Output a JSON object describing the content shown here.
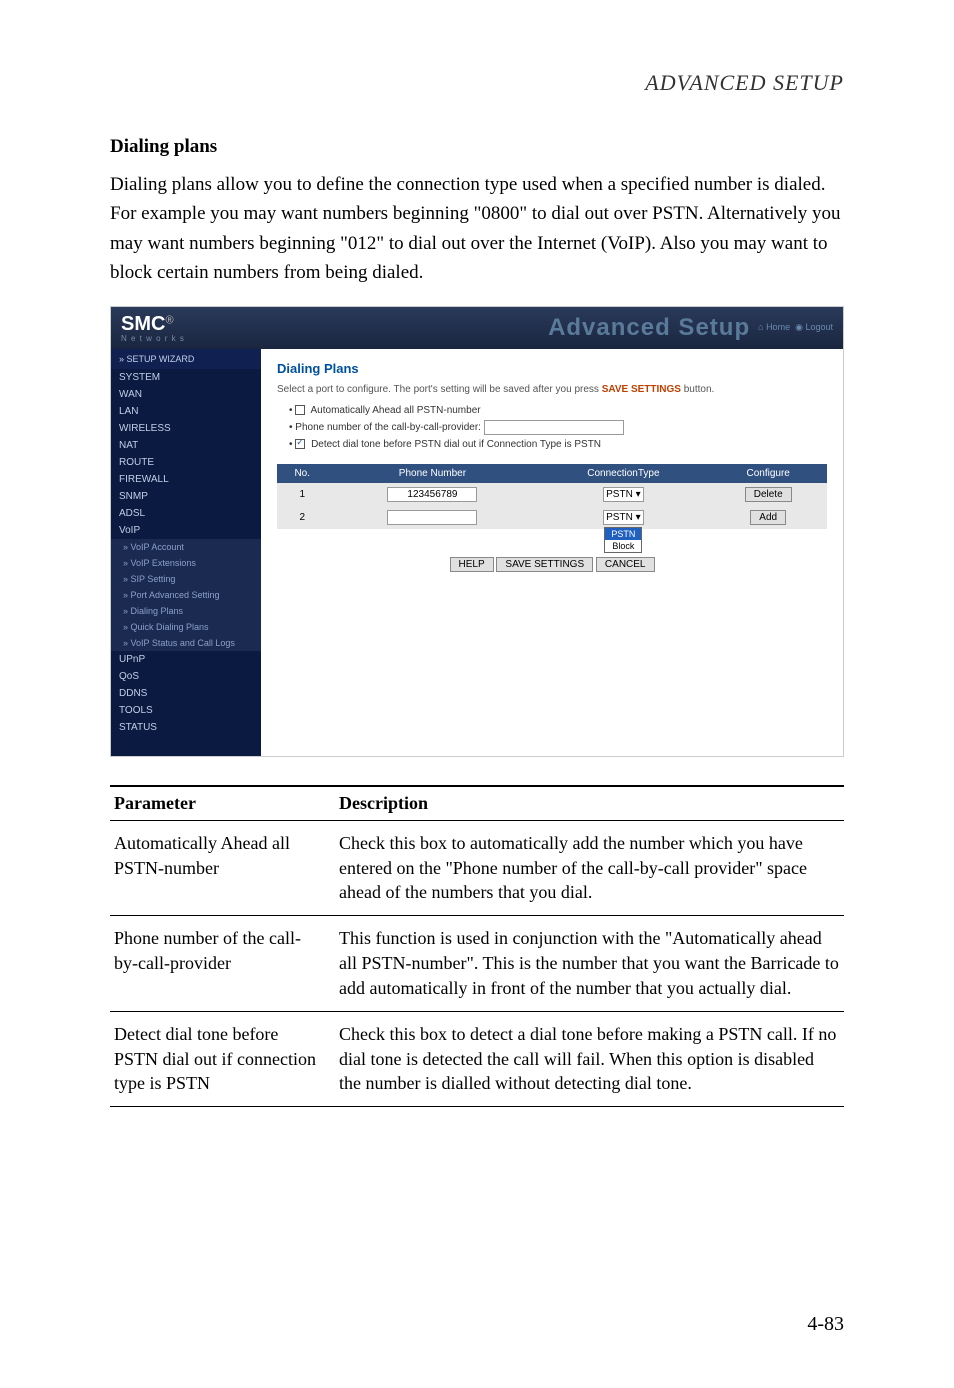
{
  "header": "ADVANCED SETUP",
  "section": {
    "title": "Dialing plans",
    "para": "Dialing plans allow you to define the connection type used when a specified number is dialed. For example you may want numbers beginning \"0800\" to dial out over PSTN. Alternatively you may want numbers beginning \"012\" to dial out over the Internet (VoIP). Also you may want to block certain numbers from being dialed."
  },
  "screenshot": {
    "logo": "SMC",
    "logo_sub": "N e t w o r k s",
    "adv": "Advanced Setup",
    "right_home": "Home",
    "right_logout": "Logout",
    "sidebar": {
      "wizard": "» SETUP WIZARD",
      "items": [
        "SYSTEM",
        "WAN",
        "LAN",
        "WIRELESS",
        "NAT",
        "ROUTE",
        "FIREWALL",
        "SNMP",
        "ADSL",
        "VoIP"
      ],
      "subs": [
        "» VoIP Account",
        "» VoIP Extensions",
        "» SIP Setting",
        "» Port Advanced Setting",
        "» Dialing Plans",
        "» Quick Dialing Plans",
        "» VoIP Status and Call Logs"
      ],
      "items2": [
        "UPnP",
        "QoS",
        "DDNS",
        "TOOLS",
        "STATUS"
      ]
    },
    "main": {
      "title": "Dialing Plans",
      "note_pre": "Select a port to configure. The port's setting will be saved after you press ",
      "note_bold": "SAVE SETTINGS",
      "note_post": " button.",
      "bul1": "Automatically Ahead all PSTN-number",
      "bul2": "Phone number of the call-by-call-provider:",
      "bul3": "Detect dial tone before PSTN dial out if Connection Type is PSTN",
      "th_no": "No.",
      "th_phone": "Phone Number",
      "th_conn": "ConnectionType",
      "th_conf": "Configure",
      "row1_no": "1",
      "row1_phone": "123456789",
      "row1_conn": "PSTN",
      "row1_btn": "Delete",
      "row2_no": "2",
      "row2_conn": "PSTN",
      "row2_btn": "Add",
      "dd1": "PSTN",
      "dd2": "Block",
      "btn_help": "HELP",
      "btn_save": "SAVE SETTINGS",
      "btn_cancel": "CANCEL"
    }
  },
  "table": {
    "h1": "Parameter",
    "h2": "Description",
    "rows": [
      {
        "p": "Automatically Ahead all PSTN-number",
        "d": "Check this box to automatically add the number which you have entered on the \"Phone number of the call-by-call provider\" space ahead of the numbers that you dial."
      },
      {
        "p": "Phone number of the call-by-call-provider",
        "d": "This function is used in conjunction with the \"Automatically ahead all PSTN-number\". This is the number that you want the Barricade to add automatically in front of the number that you actually dial."
      },
      {
        "p": "Detect dial tone before PSTN dial out if connection type is PSTN",
        "d": "Check this box to detect a dial tone before making a PSTN call. If no dial tone is detected the call will fail. When this option is disabled the number is dialled without detecting dial tone."
      }
    ]
  },
  "pagenum": "4-83"
}
